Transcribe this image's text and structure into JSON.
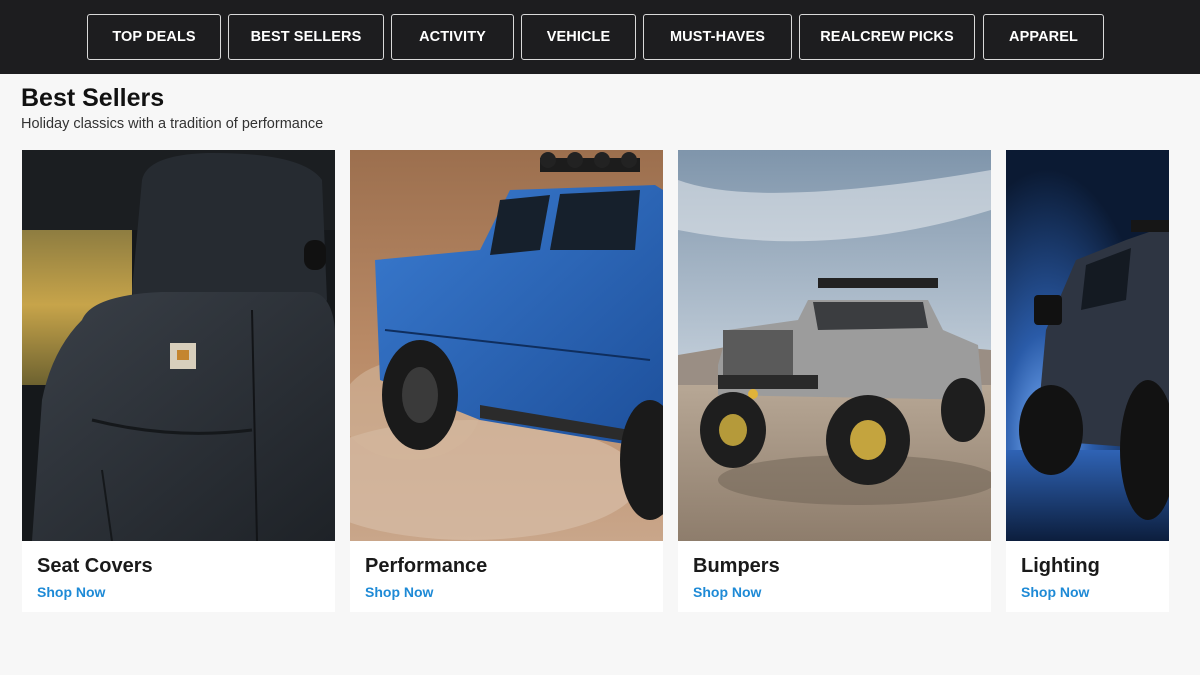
{
  "nav": {
    "items": [
      {
        "label": "TOP DEALS"
      },
      {
        "label": "BEST SELLERS"
      },
      {
        "label": "ACTIVITY"
      },
      {
        "label": "VEHICLE"
      },
      {
        "label": "MUST-HAVES"
      },
      {
        "label": "REALCREW PICKS"
      },
      {
        "label": "APPAREL"
      }
    ]
  },
  "section": {
    "title": "Best Sellers",
    "subtitle": "Holiday classics with a tradition of performance"
  },
  "cards": [
    {
      "title": "Seat Covers",
      "link": "Shop Now",
      "image": "black-seat-cover"
    },
    {
      "title": "Performance",
      "link": "Shop Now",
      "image": "blue-pickup-truck-offroad"
    },
    {
      "title": "Bumpers",
      "link": "Shop Now",
      "image": "lifted-jeep-desert"
    },
    {
      "title": "Lighting",
      "link": "Shop Now",
      "image": "dark-truck-blue-lights"
    }
  ],
  "colors": {
    "nav_bg": "#1d1d1f",
    "page_bg": "#f7f7f7",
    "link": "#1e8ad6"
  }
}
